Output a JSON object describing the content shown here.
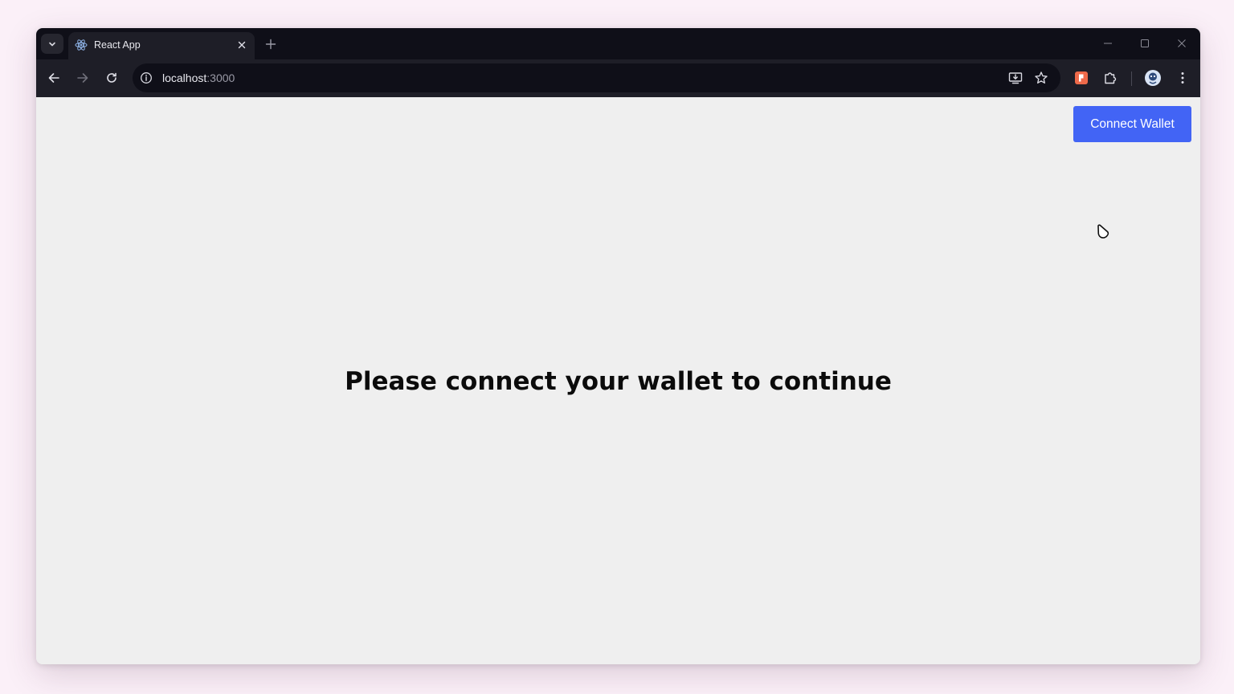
{
  "browser": {
    "tab": {
      "title": "React App",
      "favicon": "react-logo-icon"
    },
    "address": {
      "host": "localhost",
      "port": ":3000"
    }
  },
  "page": {
    "connect_button_label": "Connect Wallet",
    "message": "Please connect your wallet to continue"
  },
  "colors": {
    "accent": "#4264f5",
    "page_background": "#efefef",
    "chrome_dark": "#0f0f18",
    "chrome_toolbar": "#1e1e27"
  }
}
